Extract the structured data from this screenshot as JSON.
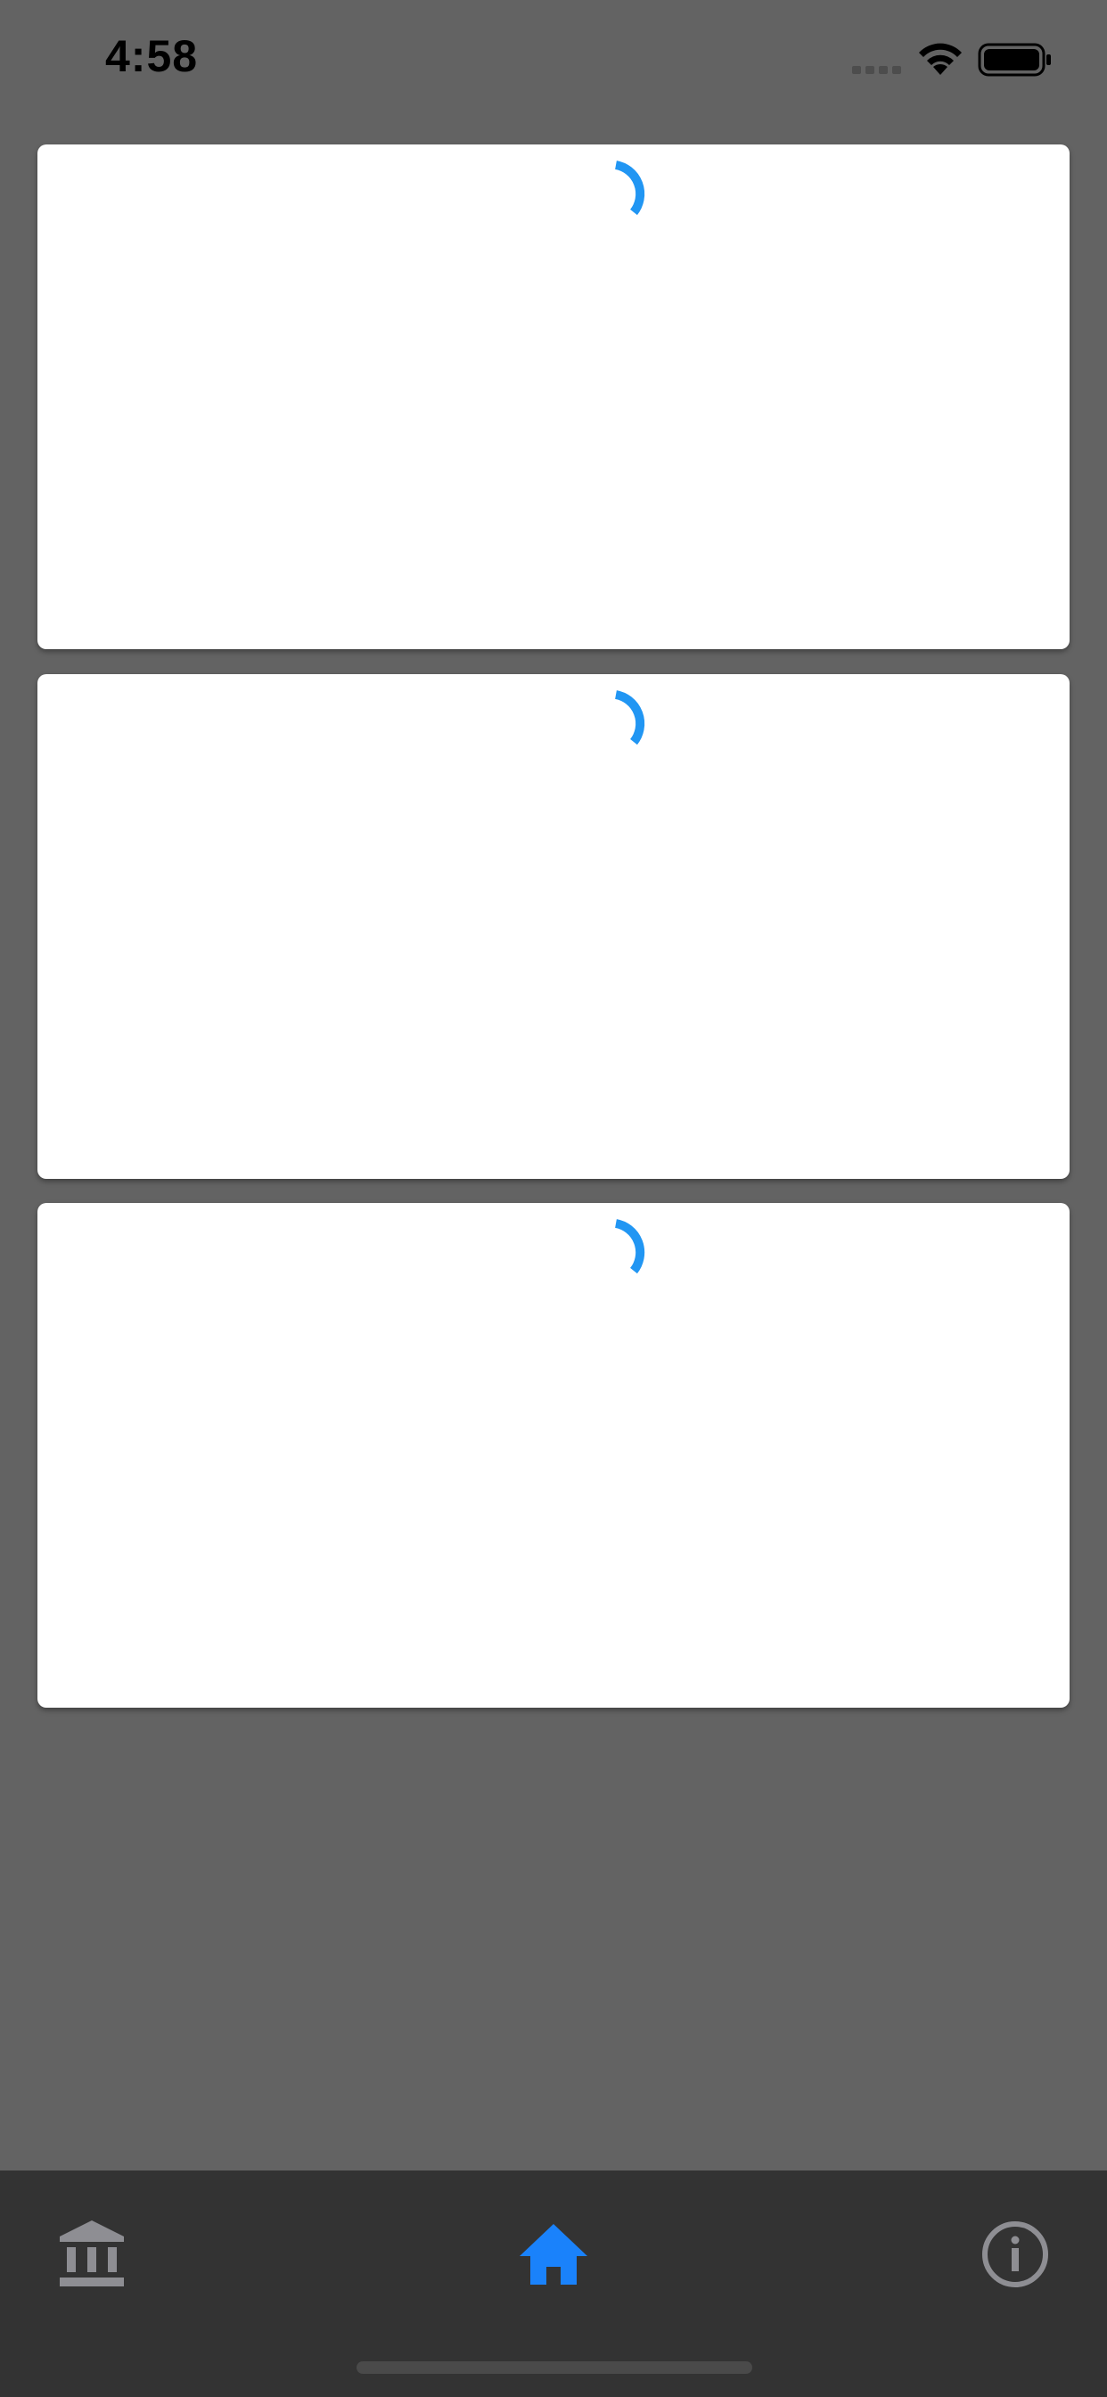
{
  "status_bar": {
    "time": "4:58",
    "signal_icon": "cellular-signal-icon",
    "wifi_icon": "wifi-icon",
    "battery_icon": "battery-full-icon"
  },
  "colors": {
    "background": "#636363",
    "card": "#ffffff",
    "spinner": "#2196f3",
    "tab_bar": "#333333",
    "tab_active": "#1a82fb",
    "tab_inactive": "#8e8e93"
  },
  "cards": [
    {
      "state": "loading",
      "indicator": "loading-spinner-icon"
    },
    {
      "state": "loading",
      "indicator": "loading-spinner-icon"
    },
    {
      "state": "loading",
      "indicator": "loading-spinner-icon"
    }
  ],
  "tab_bar": {
    "tabs": [
      {
        "icon": "bank-icon",
        "active": false
      },
      {
        "icon": "home-icon",
        "active": true
      },
      {
        "icon": "info-icon",
        "active": false
      }
    ]
  }
}
